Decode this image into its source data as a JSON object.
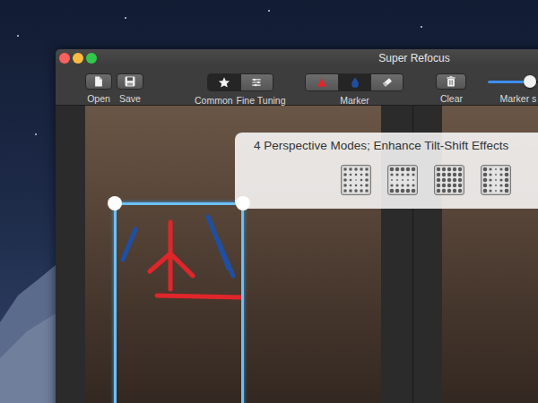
{
  "window": {
    "title": "Super Refocus"
  },
  "toolbar": {
    "file_buttons": [
      {
        "label": "Open",
        "kind": "open"
      },
      {
        "label": "Save",
        "kind": "save"
      }
    ],
    "mode_tabs": [
      {
        "label": "Common",
        "kind": "star",
        "selected": true
      },
      {
        "label": "Fine Tuning",
        "kind": "sliders",
        "selected": false
      }
    ],
    "marker": {
      "label": "Marker",
      "tools": [
        {
          "kind": "focus",
          "color": "#e0262b",
          "selected": false
        },
        {
          "kind": "background",
          "color": "#1f4fa3",
          "selected": true
        },
        {
          "kind": "eraser",
          "selected": false
        }
      ]
    },
    "clear": {
      "label": "Clear"
    },
    "marker_size": {
      "label": "Marker s",
      "level": 0.42
    }
  },
  "callout": {
    "text": "4 Perspective Modes; Enhance Tilt-Shift Effects",
    "modes": [
      {
        "kind": "center"
      },
      {
        "kind": "horizontal"
      },
      {
        "kind": "dense"
      },
      {
        "kind": "vertical"
      }
    ]
  }
}
